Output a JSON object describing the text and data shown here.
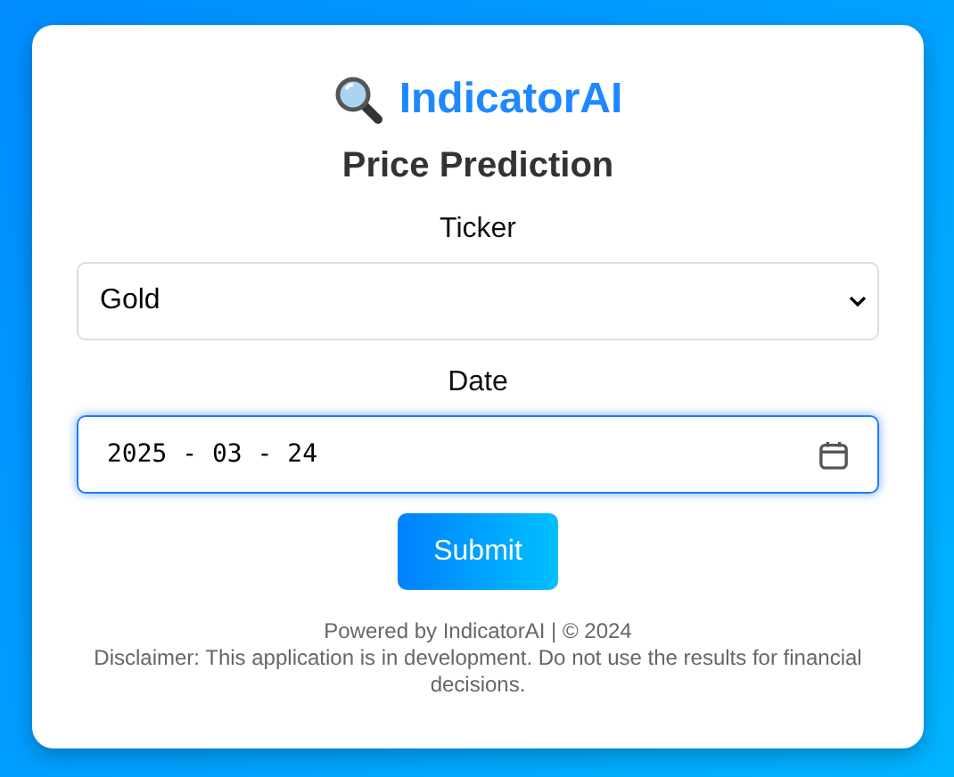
{
  "app_title": "IndicatorAI",
  "heading": "Price Prediction",
  "fields": [
    {
      "kind": "select",
      "label": "Ticker",
      "value": "Gold",
      "focused": false
    },
    {
      "kind": "date",
      "label": "Date",
      "value": "2025 - 03 - 24",
      "focused": true
    }
  ],
  "submit_button": "Submit",
  "footer": [
    "Powered by IndicatorAI | © 2024",
    "Disclaimer: This application is in development. Do not use the results for financial decisions."
  ]
}
